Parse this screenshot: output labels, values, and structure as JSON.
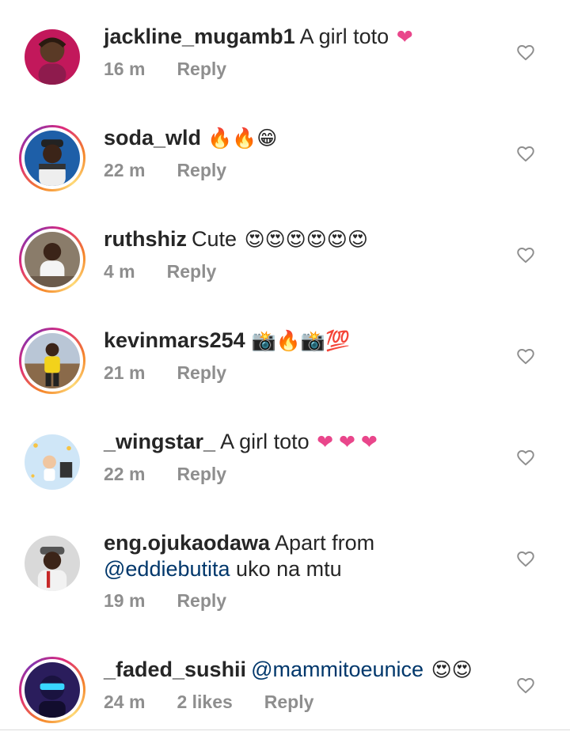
{
  "comments": [
    {
      "username": "jackline_mugamb1",
      "text": "A girl toto",
      "emojis": "❤",
      "emoji_kind": "heart",
      "time": "16 m",
      "likes": "",
      "reply_label": "Reply",
      "has_story_ring": false,
      "avatar_icon": "avatar-woman-braids",
      "avatar_bg": "#c2185b"
    },
    {
      "username": "soda_wld",
      "text": "",
      "emojis": "🔥🔥😁",
      "emoji_kind": "emoji",
      "time": "22 m",
      "likes": "",
      "reply_label": "Reply",
      "has_story_ring": true,
      "avatar_icon": "avatar-man-cap",
      "avatar_bg": "#1e5fa8"
    },
    {
      "username": "ruthshiz",
      "text": "Cute",
      "emojis": "😍😍😍😍😍😍",
      "emoji_kind": "emoji",
      "time": "4 m",
      "likes": "",
      "reply_label": "Reply",
      "has_story_ring": true,
      "avatar_icon": "avatar-woman-seated",
      "avatar_bg": "#8a7c6a"
    },
    {
      "username": "kevinmars254",
      "text": "",
      "emojis": "📸🔥📸💯",
      "emoji_kind": "emoji",
      "time": "21 m",
      "likes": "",
      "reply_label": "Reply",
      "has_story_ring": true,
      "avatar_icon": "avatar-man-yellow-shirt",
      "avatar_bg": "#b9c6d6"
    },
    {
      "username": "_wingstar_",
      "text": "A girl toto",
      "emojis": "❤ ❤ ❤",
      "emoji_kind": "heart",
      "time": "22 m",
      "likes": "",
      "reply_label": "Reply",
      "has_story_ring": false,
      "avatar_icon": "avatar-baby-stars",
      "avatar_bg": "#cfe6f7"
    },
    {
      "username": "eng.ojukaodawa",
      "text": "Apart from",
      "mention": "@eddiebutita",
      "text_after": "uko na mtu",
      "emojis": "",
      "emoji_kind": "",
      "time": "19 m",
      "likes": "",
      "reply_label": "Reply",
      "has_story_ring": false,
      "avatar_icon": "avatar-man-hat",
      "avatar_bg": "#d9d9d9"
    },
    {
      "username": "_faded_sushii",
      "text": "",
      "mention": "@mammitoeunice",
      "emojis": "😍😍",
      "emoji_kind": "emoji",
      "time": "24 m",
      "likes": "2 likes",
      "reply_label": "Reply",
      "has_story_ring": true,
      "avatar_icon": "avatar-neon-glasses",
      "avatar_bg": "#2a1d5c"
    }
  ]
}
